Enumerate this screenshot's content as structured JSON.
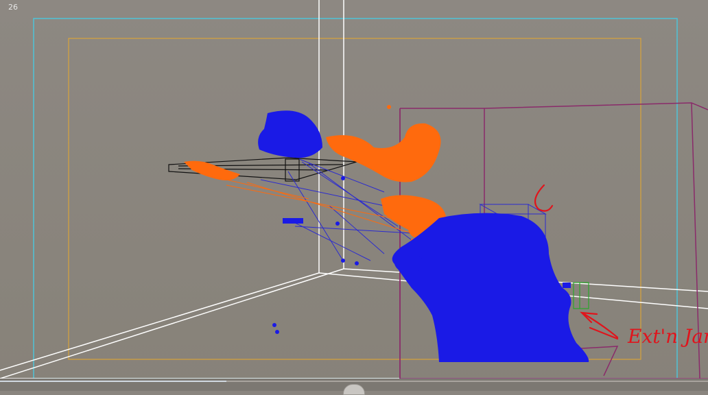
{
  "viewport": {
    "frame_number": "26",
    "colors": {
      "background": "#8a857f",
      "safe_frame_outer": "#4fc3d8",
      "safe_frame_inner": "#d9a43a",
      "grid": "#ffffff",
      "particles_primary": "#1a1ae6",
      "particles_secondary": "#ff6a0d",
      "helper_box": "#8a2a6a",
      "annotation": "#e0141c"
    },
    "icons": [
      "wireframe-emitter-icon",
      "helper-box-icon",
      "annotation-arrow-icon"
    ]
  },
  "annotation": {
    "handwritten_text": "Ext'n Jank"
  },
  "timeline": {
    "progress_fraction": 0.32
  }
}
